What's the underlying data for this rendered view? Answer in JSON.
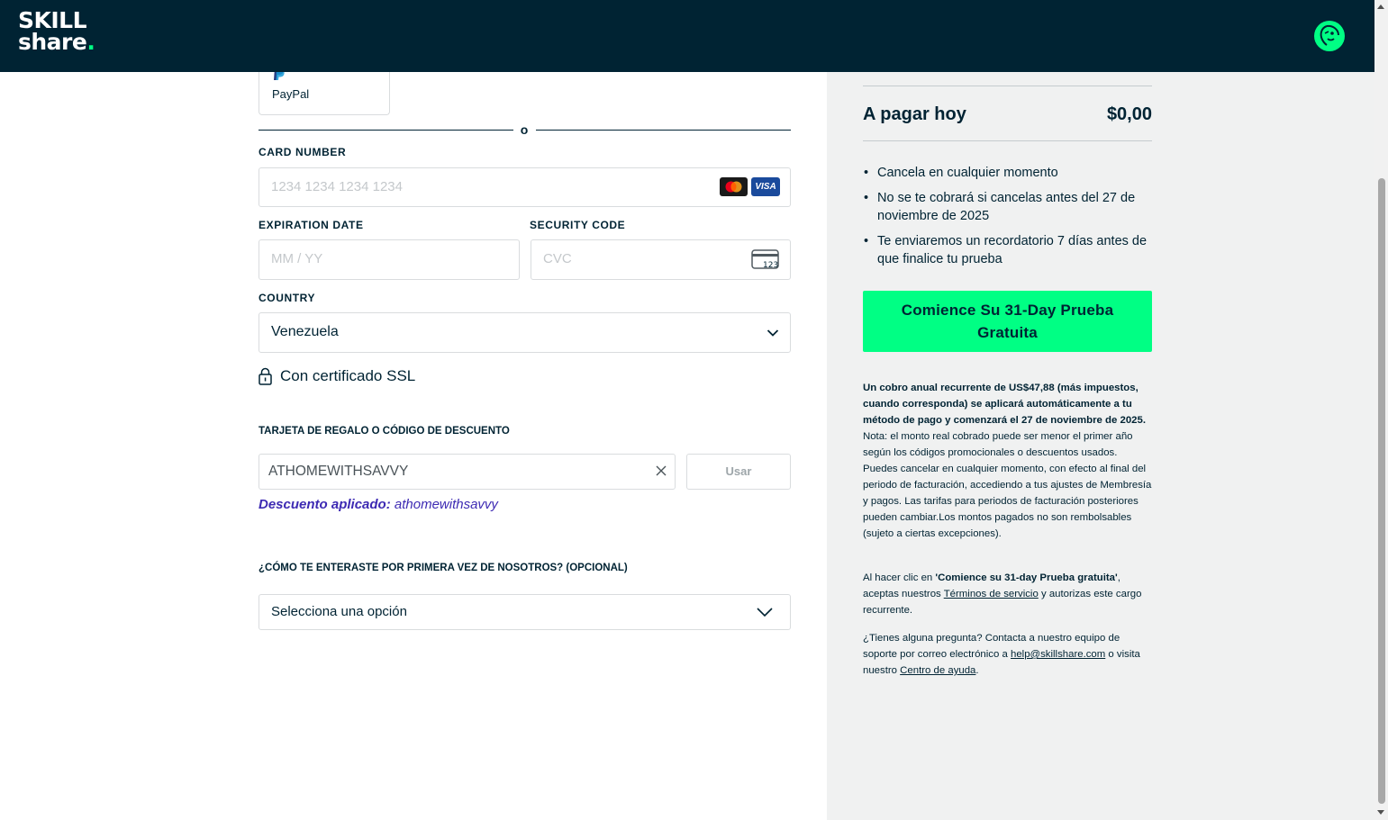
{
  "brand": {
    "logo_line1": "SKILL",
    "logo_line2": "share",
    "logo_dot": ".",
    "accent_color": "#00ff84",
    "header_color": "#002333"
  },
  "payment_methods": {
    "paypal_label": "PayPal",
    "divider_text": "o"
  },
  "card_number": {
    "label": "CARD NUMBER",
    "placeholder": "1234 1234 1234 1234",
    "brands": [
      "mastercard-icon",
      "visa-icon"
    ],
    "visa_text": "VISA"
  },
  "expiration": {
    "label": "EXPIRATION DATE",
    "placeholder": "MM / YY"
  },
  "security_code": {
    "label": "SECURITY CODE",
    "placeholder": "CVC",
    "icon_text": "123"
  },
  "country": {
    "label": "COUNTRY",
    "value": "Venezuela"
  },
  "ssl": {
    "text": "Con certificado SSL"
  },
  "promo": {
    "label": "TARJETA DE REGALO O CÓDIGO DE DESCUENTO",
    "value": "ATHOMEWITHSAVVY",
    "apply_button": "Usar",
    "applied_prefix": "Descuento aplicado:",
    "applied_code": "athomewithsavvy"
  },
  "referral": {
    "label": "¿CÓMO TE ENTERASTE POR PRIMERA VEZ DE NOSOTROS? (OPCIONAL)",
    "value": "Selecciona una opción"
  },
  "summary": {
    "total_label": "A pagar hoy",
    "total_value": "$0,00",
    "bullets": [
      "Cancela en cualquier momento",
      "No se te cobrará si cancelas antes del 27 de noviembre de 2025",
      "Te enviaremos un recordatorio 7 días antes de que finalice tu prueba"
    ],
    "cta_label": "Comience Su 31-Day Prueba Gratuita"
  },
  "legal": {
    "p1_bold": "Un cobro anual recurrente de US$47,88 (más impuestos, cuando corresponda) se aplicará automáticamente a tu método de pago y comenzará el 27 de noviembre de 2025.",
    "p1_rest": " Nota: el monto real cobrado puede ser menor el primer año según los códigos promocionales o descuentos usados. Puedes cancelar en cualquier momento, con efecto al final del periodo de facturación, accediendo a tus ajustes de Membresía y pagos. Las tarifas para periodos de facturación posteriores pueden cambiar.Los montos pagados no son rembolsables (sujeto a ciertas excepciones).",
    "p2_a": "Al hacer clic en ",
    "p2_bold": "'Comience su 31-day Prueba gratuita'",
    "p2_b": ", aceptas nuestros ",
    "p2_link": "Términos de servicio",
    "p2_c": " y autorizas este cargo recurrente.",
    "p3_a": "¿Tienes alguna pregunta? Contacta a nuestro equipo de soporte por correo electrónico a ",
    "p3_email": "help@skillshare.com",
    "p3_b": " o visita nuestro ",
    "p3_link": "Centro de ayuda",
    "p3_c": "."
  }
}
